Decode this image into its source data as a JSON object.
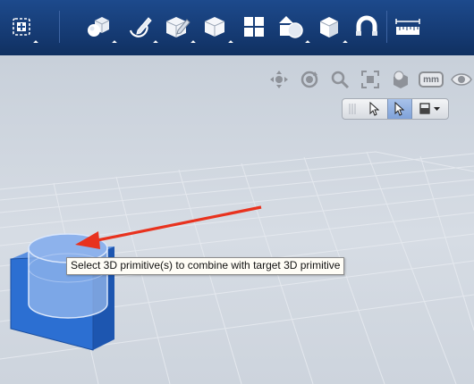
{
  "toolbar": {
    "tools": [
      {
        "name": "main-menu-icon"
      },
      {
        "name": "primitives-icon"
      },
      {
        "name": "sketch-icon"
      },
      {
        "name": "construct-icon"
      },
      {
        "name": "modify-icon"
      },
      {
        "name": "pattern-icon"
      },
      {
        "name": "combine-icon"
      },
      {
        "name": "group-icon"
      },
      {
        "name": "snap-icon"
      },
      {
        "name": "measure-icon"
      }
    ]
  },
  "nav": {
    "units_label": "mm",
    "tools": [
      "pan-icon",
      "orbit-icon",
      "zoom-icon",
      "fit-icon",
      "view-cube-icon",
      "units-button",
      "visibility-icon"
    ]
  },
  "select_bar": {
    "modes": [
      "select-icon",
      "select-active-icon",
      "material-icon"
    ]
  },
  "tooltip": {
    "text": "Select 3D primitive(s) to combine with target 3D primitive"
  },
  "colors": {
    "toolbar_bg": "#14386f",
    "box_blue": "#2a6ad0",
    "cylinder_blue": "#7ea7e6",
    "arrow_red": "#e8321e"
  }
}
